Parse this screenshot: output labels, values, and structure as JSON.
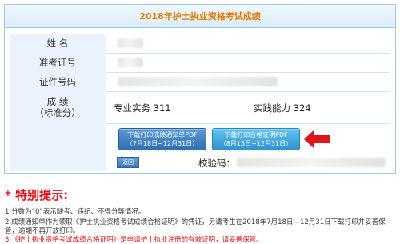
{
  "header": {
    "title": "2018年护士执业资格考试成绩"
  },
  "rows": {
    "name_label": "姓  名",
    "exam_id_label": "准考证号",
    "id_label": "证件号码",
    "score_label_1": "成  绩",
    "score_label_2": "（标准分）"
  },
  "scores": {
    "professional_label": "专业实务",
    "professional_value": "311",
    "practical_label": "实践能力",
    "practical_value": "324"
  },
  "buttons": {
    "notice_line1": "下载打印成绩通知单PDF",
    "notice_line2": "（7月18日~12月31日）",
    "cert_line1": "下载打印合格证明PDF",
    "cert_line2": "（8月15日~12月31日）",
    "back": "返回"
  },
  "checksum": {
    "label": "校验码："
  },
  "tips": {
    "title": "* 特别提示:",
    "line1": "1.分数为“0”表示缺考、违纪、不得分等情况。",
    "line2": "2.成绩通知单作为领取《护士执业资格考试成绩合格证明》的凭证，另请考生在2018年7月18日—12月31日下载打印并妥善保",
    "line3": "管，逾期不再开放打印。",
    "line4": "3.《护士执业资格考试成绩合格证明》是申请护士执业注册的有效证明，请妥善保管。"
  },
  "colors": {
    "accent_orange": "#e07b00",
    "alert_red": "#e0141b",
    "border_blue": "#9cc7e6"
  }
}
